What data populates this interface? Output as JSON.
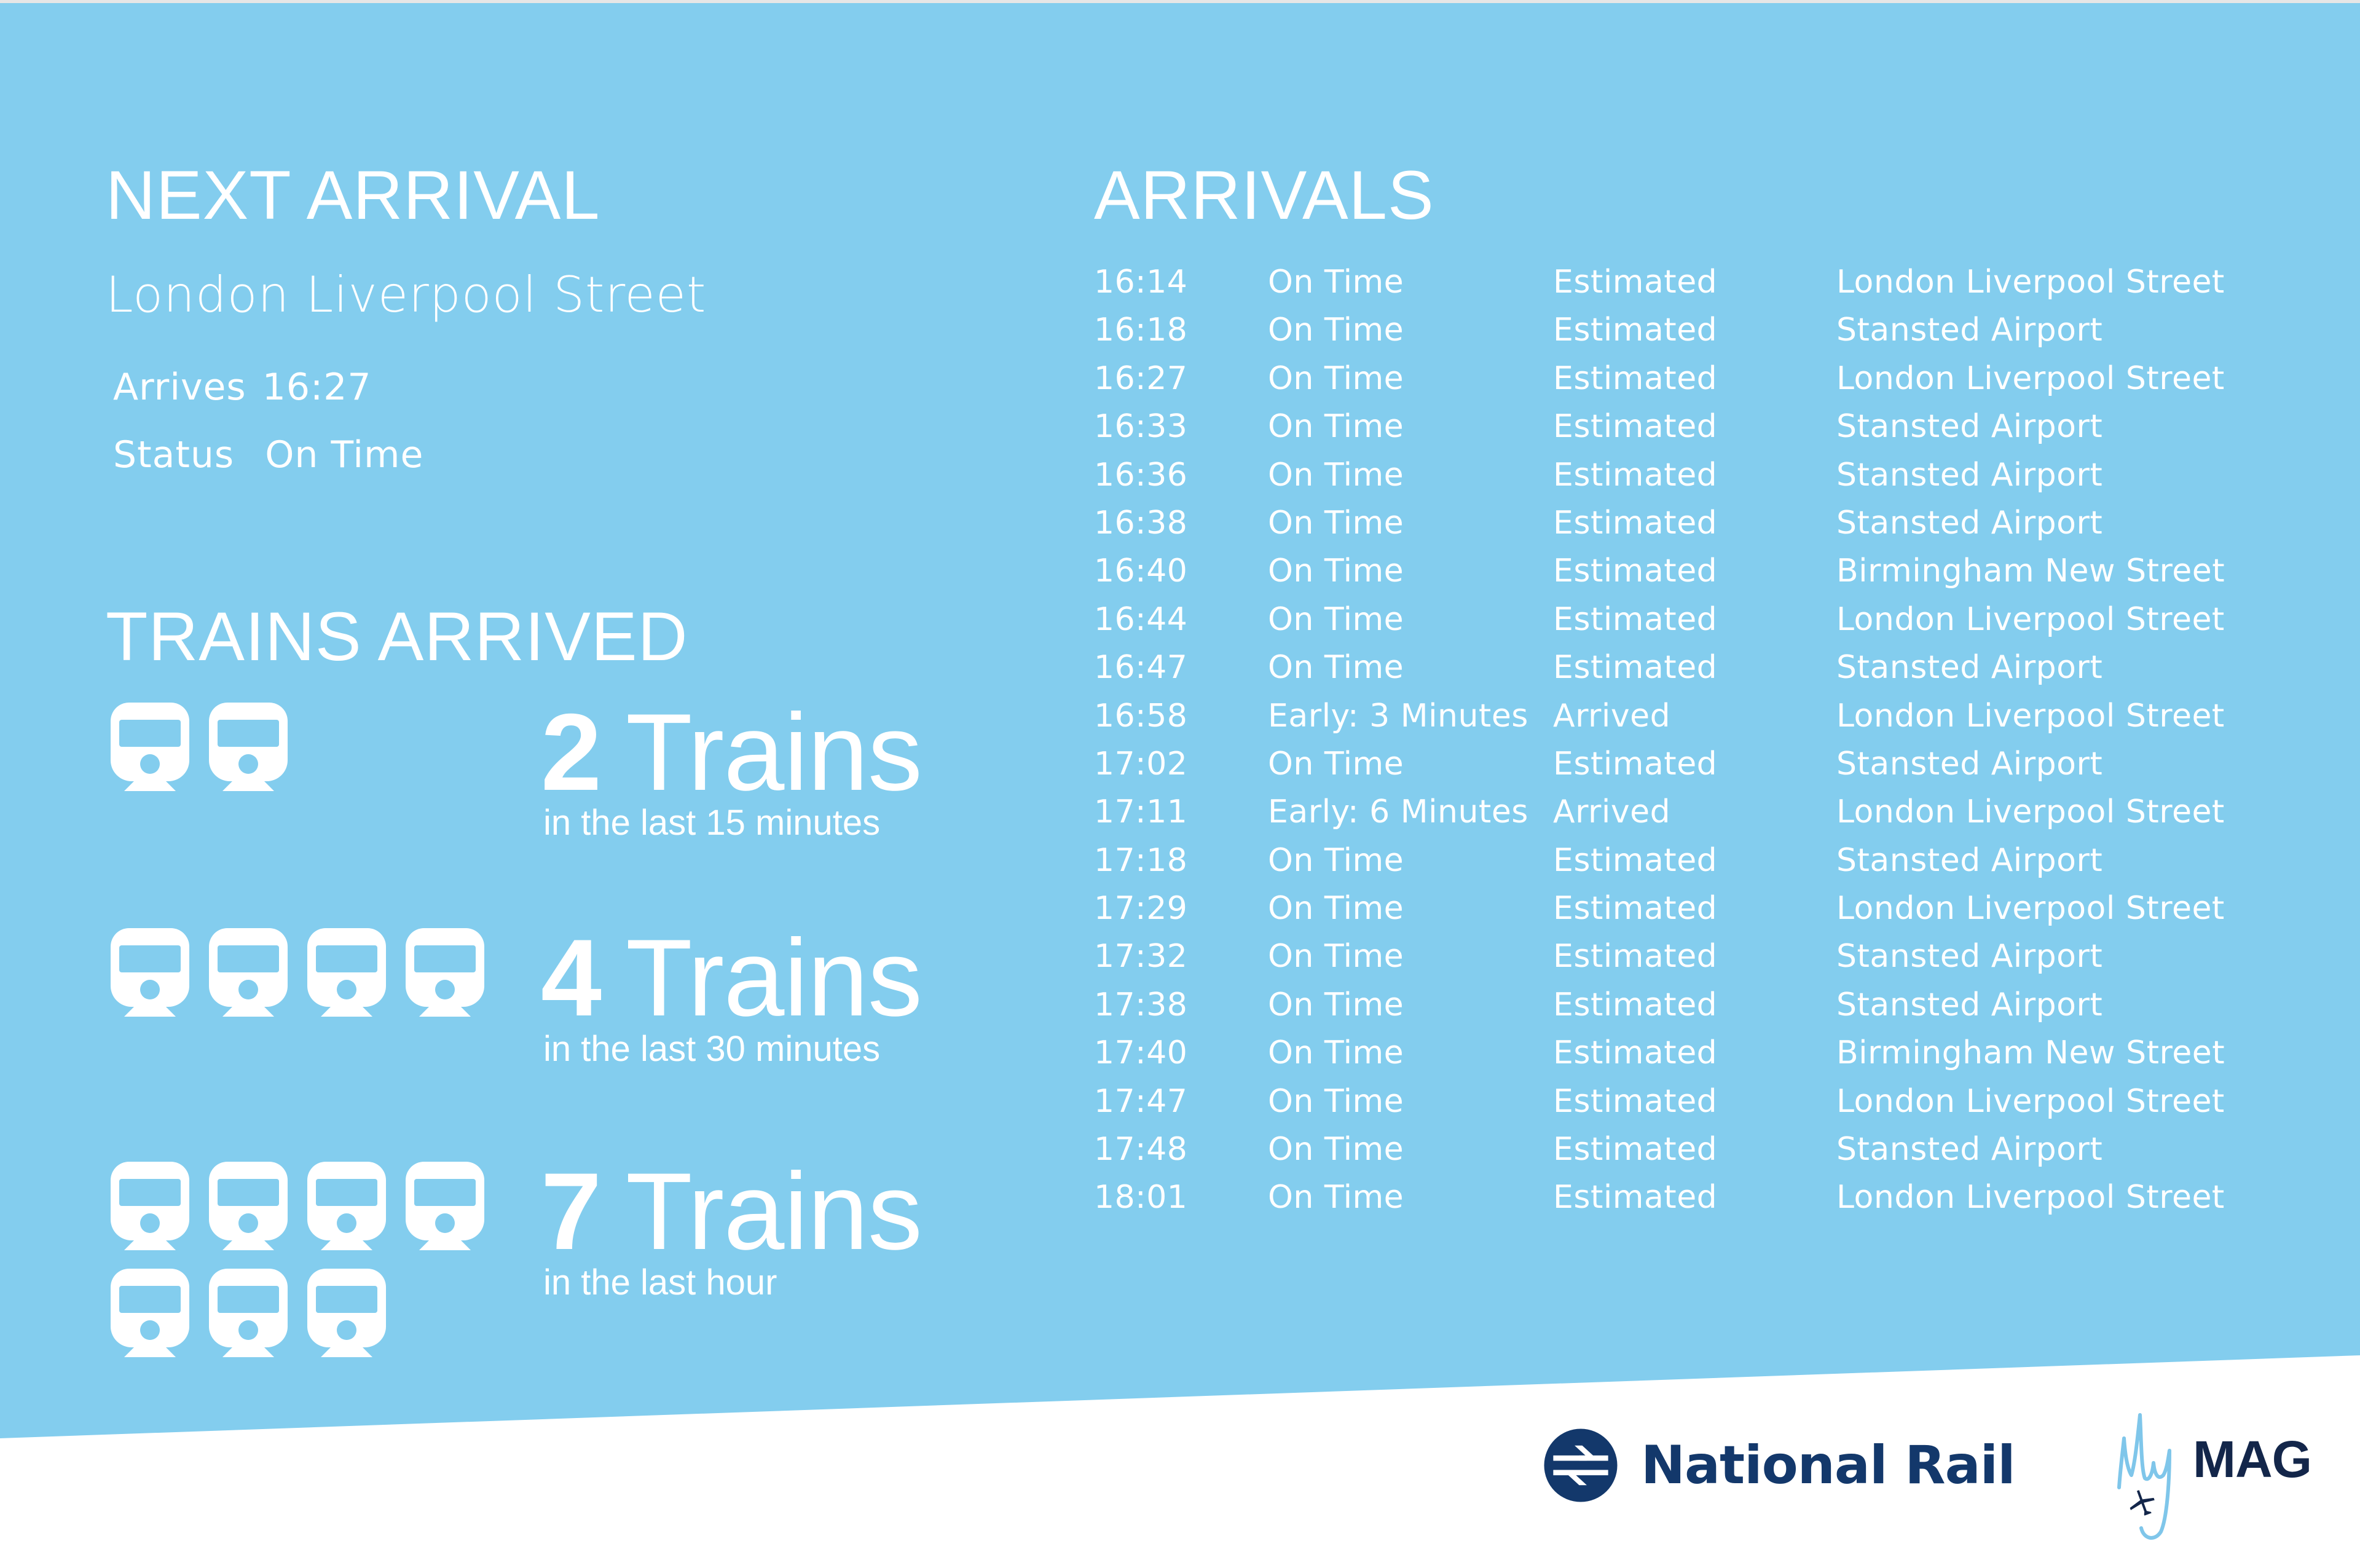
{
  "colors": {
    "background_blue": "#83CDEE",
    "text": "#FFFFFF",
    "national_rail_navy": "#13386B",
    "mag_navy": "#13264A",
    "mag_light_blue": "#7FC6EA"
  },
  "next_arrival": {
    "title": "NEXT ARRIVAL",
    "destination": "London Liverpool Street",
    "arrives_label": "Arrives",
    "arrives_value": "16:27",
    "status_label": "Status",
    "status_value": "On Time"
  },
  "trains_arrived": {
    "title": "TRAINS ARRIVED",
    "icon": "train-icon",
    "groups": [
      {
        "count": 2,
        "count_label": "2",
        "unit": "Trains",
        "period": "in the last 15 minutes"
      },
      {
        "count": 4,
        "count_label": "4",
        "unit": "Trains",
        "period": "in the last 30 minutes"
      },
      {
        "count": 7,
        "count_label": "7",
        "unit": "Trains",
        "period": "in the last hour"
      }
    ]
  },
  "arrivals": {
    "title": "ARRIVALS",
    "rows": [
      {
        "time": "16:14",
        "status": "On Time",
        "state": "Estimated",
        "destination": "London Liverpool Street"
      },
      {
        "time": "16:18",
        "status": "On Time",
        "state": "Estimated",
        "destination": "Stansted Airport"
      },
      {
        "time": "16:27",
        "status": "On Time",
        "state": "Estimated",
        "destination": "London Liverpool Street"
      },
      {
        "time": "16:33",
        "status": "On Time",
        "state": "Estimated",
        "destination": "Stansted Airport"
      },
      {
        "time": "16:36",
        "status": "On Time",
        "state": "Estimated",
        "destination": "Stansted Airport"
      },
      {
        "time": "16:38",
        "status": "On Time",
        "state": "Estimated",
        "destination": "Stansted Airport"
      },
      {
        "time": "16:40",
        "status": "On Time",
        "state": "Estimated",
        "destination": "Birmingham New Street"
      },
      {
        "time": "16:44",
        "status": "On Time",
        "state": "Estimated",
        "destination": "London Liverpool Street"
      },
      {
        "time": "16:47",
        "status": "On Time",
        "state": "Estimated",
        "destination": "Stansted Airport"
      },
      {
        "time": "16:58",
        "status": "Early: 3 Minutes",
        "state": "Arrived",
        "destination": "London Liverpool Street"
      },
      {
        "time": "17:02",
        "status": "On Time",
        "state": "Estimated",
        "destination": "Stansted Airport"
      },
      {
        "time": "17:11",
        "status": "Early: 6 Minutes",
        "state": "Arrived",
        "destination": "London Liverpool Street"
      },
      {
        "time": "17:18",
        "status": "On Time",
        "state": "Estimated",
        "destination": "Stansted Airport"
      },
      {
        "time": "17:29",
        "status": "On Time",
        "state": "Estimated",
        "destination": "London Liverpool Street"
      },
      {
        "time": "17:32",
        "status": "On Time",
        "state": "Estimated",
        "destination": "Stansted Airport"
      },
      {
        "time": "17:38",
        "status": "On Time",
        "state": "Estimated",
        "destination": "Stansted Airport"
      },
      {
        "time": "17:40",
        "status": "On Time",
        "state": "Estimated",
        "destination": "Birmingham New Street"
      },
      {
        "time": "17:47",
        "status": "On Time",
        "state": "Estimated",
        "destination": "London Liverpool Street"
      },
      {
        "time": "17:48",
        "status": "On Time",
        "state": "Estimated",
        "destination": "Stansted Airport"
      },
      {
        "time": "18:01",
        "status": "On Time",
        "state": "Estimated",
        "destination": "London Liverpool Street"
      }
    ]
  },
  "footer": {
    "national_rail": {
      "text": "National Rail",
      "icon": "double-arrow-icon"
    },
    "mymag": {
      "script_text": "My",
      "text": "MAG",
      "icon": "airplane-icon"
    }
  }
}
